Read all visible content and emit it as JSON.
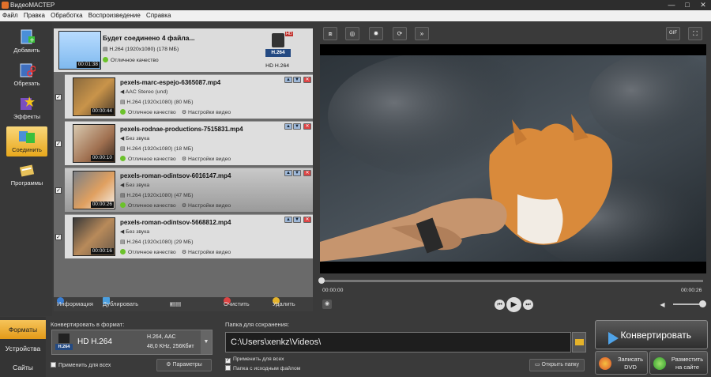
{
  "window": {
    "title": "ВидеоМАСТЕР",
    "controls": [
      "—",
      "□",
      "✕"
    ]
  },
  "menu": [
    "Файл",
    "Правка",
    "Обработка",
    "Воспроизведение",
    "Справка"
  ],
  "left_tools": [
    {
      "label": "Добавить",
      "icon": "add-file-icon",
      "active": false
    },
    {
      "label": "Обрезать",
      "icon": "trim-icon",
      "active": false
    },
    {
      "label": "Эффекты",
      "icon": "effects-icon",
      "active": false
    },
    {
      "label": "Соединить",
      "icon": "join-icon",
      "active": true
    },
    {
      "label": "Программы",
      "icon": "programs-icon",
      "active": false
    }
  ],
  "group": {
    "title": "Будет соединено 4 файла...",
    "info": "H.264 (1920x1080) (178 МБ)",
    "quality": "Отличное качество",
    "duration": "00:01:38",
    "format_badge": "H.264",
    "format_hd": "HD",
    "format_caption": "HD H.264"
  },
  "clips": [
    {
      "name": "pexels-marc-espejo-6365087.mp4",
      "audio": "AAC Stereo (und)",
      "video": "H.264 (1920x1080) (80 МБ)",
      "quality": "Отличное качество",
      "settings": "Настройки видео",
      "duration": "00:00:44",
      "checked": true,
      "selected": false
    },
    {
      "name": "pexels-rodnae-productions-7515831.mp4",
      "audio": "Без звука",
      "video": "H.264 (1920x1080) (18 МБ)",
      "quality": "Отличное качество",
      "settings": "Настройки видео",
      "duration": "00:00:10",
      "checked": true,
      "selected": false
    },
    {
      "name": "pexels-roman-odintsov-6016147.mp4",
      "audio": "Без звука",
      "video": "H.264 (1920x1080) (47 МБ)",
      "quality": "Отличное качество",
      "settings": "Настройки видео",
      "duration": "00:00:26",
      "checked": true,
      "selected": true
    },
    {
      "name": "pexels-roman-odintsov-5668812.mp4",
      "audio": "Без звука",
      "video": "H.264 (1920x1080) (29 МБ)",
      "quality": "Отличное качество",
      "settings": "Настройки видео",
      "duration": "00:00:16",
      "checked": true,
      "selected": false
    }
  ],
  "list_toolbar": {
    "info": "Информация",
    "duplicate": "Дублировать",
    "clear": "Очистить",
    "delete": "Удалить"
  },
  "video_tools": [
    "crop-icon",
    "enhance-icon",
    "brightness-icon",
    "rotate-icon",
    "speed-icon"
  ],
  "video_tools_right": {
    "gif": "GIF",
    "fullscreen": "fullscreen-icon"
  },
  "player": {
    "current_time": "00:00:00",
    "total_time": "00:00:26",
    "progress": 0,
    "volume": 1.0
  },
  "bottom_tabs": [
    "Форматы",
    "Устройства",
    "Сайты"
  ],
  "format_panel": {
    "label": "Конвертировать в формат:",
    "format_name": "HD H.264",
    "format_badge": "H.264",
    "spec1": "H.264, AAC",
    "spec2": "48,0 KHz, 256Кбит",
    "apply_all": "Применить для всех",
    "params": "Параметры"
  },
  "save_panel": {
    "label": "Папка для сохранения:",
    "path": "C:\\Users\\xenkz\\Videos\\",
    "apply_all": "Применить для всех",
    "source_folder": "Папка с исходным файлом",
    "open_folder": "Открыть папку"
  },
  "actions": {
    "convert": "Конвертировать",
    "dvd_line1": "Записать",
    "dvd_line2": "DVD",
    "web_line1": "Разместить",
    "web_line2": "на сайте"
  },
  "colors": {
    "accent": "#f0b030",
    "quality_dot": "#6bc22b",
    "delete": "#d44444",
    "badge_blue": "#244a82"
  }
}
